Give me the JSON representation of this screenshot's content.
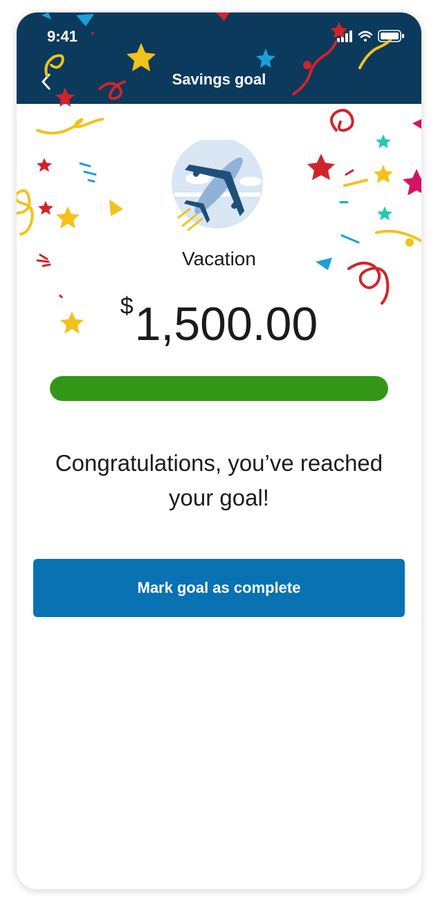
{
  "status_bar": {
    "time": "9:41",
    "icons": [
      "signal-icon",
      "wifi-icon",
      "battery-icon"
    ]
  },
  "nav": {
    "title": "Savings goal",
    "back_icon": "chevron-left-icon"
  },
  "goal": {
    "illustration": "airplane-icon",
    "name": "Vacation",
    "currency_symbol": "$",
    "amount": "1,500.00",
    "progress_fraction": 1.0
  },
  "message": {
    "line1": "Congratulations, you’ve reached",
    "line2": "your goal!"
  },
  "actions": {
    "primary_label": "Mark goal as complete"
  },
  "colors": {
    "header_bg": "#0b3a5c",
    "progress_fill": "#339616",
    "primary_button": "#0872b3",
    "confetti_red": "#d2232a",
    "confetti_yellow": "#f2c21b",
    "confetti_blue": "#1aa0d8",
    "confetti_teal": "#22c9b5",
    "confetti_magenta": "#d41367"
  }
}
